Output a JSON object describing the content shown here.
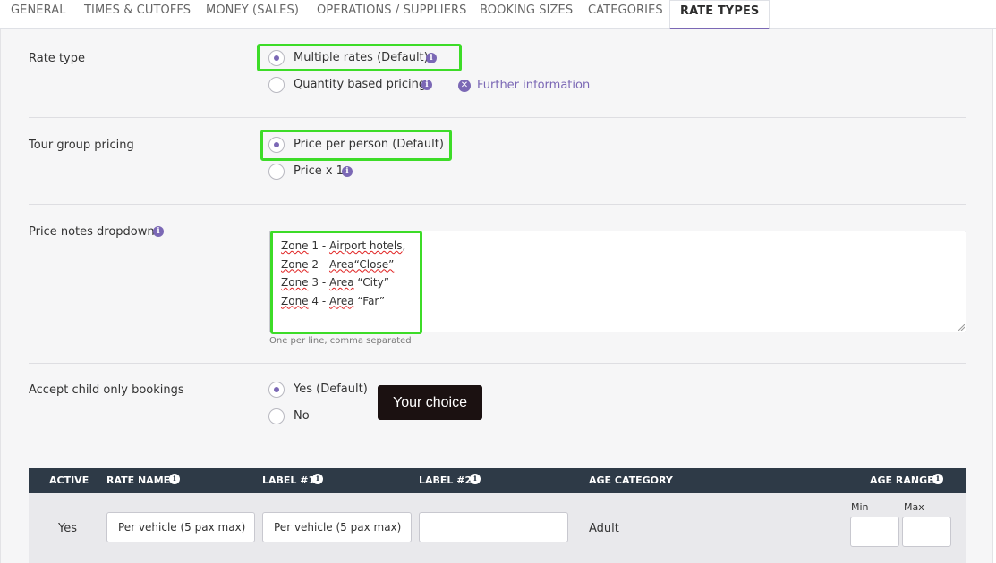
{
  "tabs": [
    {
      "label": "GENERAL"
    },
    {
      "label": "TIMES & CUTOFFS"
    },
    {
      "label": "MONEY (SALES)"
    },
    {
      "label": "OPERATIONS / SUPPLIERS"
    },
    {
      "label": "BOOKING SIZES"
    },
    {
      "label": "CATEGORIES"
    },
    {
      "label": "RATE TYPES",
      "active": true
    }
  ],
  "rate_type": {
    "label": "Rate type",
    "options": [
      {
        "label": "Multiple rates (Default)",
        "checked": true
      },
      {
        "label": "Quantity based pricing",
        "checked": false
      }
    ],
    "further_info": "Further information"
  },
  "tour_group_pricing": {
    "label": "Tour group pricing",
    "options": [
      {
        "label": "Price per person (Default)",
        "checked": true
      },
      {
        "label": "Price x 1",
        "checked": false
      }
    ]
  },
  "price_notes": {
    "label": "Price notes dropdown",
    "lines": [
      {
        "a": "Zone",
        "b": " 1 - ",
        "c": "Airport hotels",
        "d": ","
      },
      {
        "a": "Zone",
        "b": " 2 - ",
        "c": "Area“Close”",
        "d": ""
      },
      {
        "a": "Zone",
        "b": " 3 - ",
        "c": "Area",
        "d": " “City”"
      },
      {
        "a": "Zone",
        "b": " 4 - ",
        "c": "Area",
        "d": " “Far”"
      }
    ],
    "hint": "One per line, comma separated"
  },
  "child_only": {
    "label": "Accept child only bookings",
    "options": [
      {
        "label": "Yes (Default)",
        "checked": true
      },
      {
        "label": "No",
        "checked": false
      }
    ],
    "tooltip": "Your choice"
  },
  "table": {
    "headers": {
      "active": "ACTIVE",
      "rate_name": "RATE NAME",
      "label1": "LABEL #1",
      "label2": "LABEL #2",
      "age_category": "AGE CATEGORY",
      "age_range": "AGE RANGE"
    },
    "row": {
      "active": "Yes",
      "rate_name": "Per vehicle (5 pax max)",
      "label1": "Per vehicle (5 pax max)",
      "label2": "",
      "age_category": "Adult",
      "min_label": "Min",
      "max_label": "Max",
      "min": "",
      "max": ""
    }
  },
  "colors": {
    "accent": "#7b68b5",
    "highlight": "#3ddc28",
    "table_header": "#2e3a47"
  }
}
